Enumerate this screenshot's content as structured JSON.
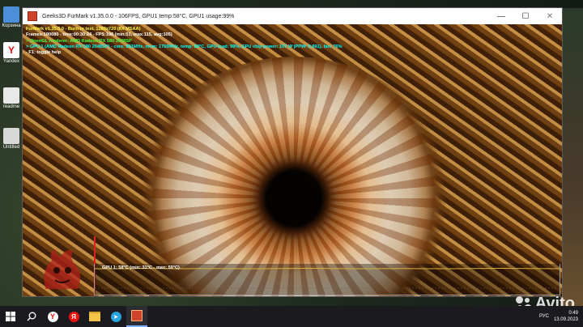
{
  "window": {
    "title": "Geeks3D FurMark v1.35.0.0 - 106FPS, GPU1 temp:58°C, GPU1 usage:99%",
    "min_glyph": "—",
    "max_glyph": "☐",
    "close_glyph": "✕"
  },
  "desktop": {
    "icons": [
      {
        "label": "Корзина"
      },
      {
        "label": "Yandex"
      },
      {
        "label": "readme"
      },
      {
        "label": "Untitled"
      }
    ]
  },
  "hud": {
    "lines": [
      "FurMark v1.35.0.0 - Burn-in test, 1280x720 (8X MSAA)",
      "Frames:190080 - time:00:30:24 - FPS:106 (min:51, max:115, avg:105)",
      "> OpenGL renderer: AMD Radeon RX 580 2048SP",
      "> GPU 1 (AMD Radeon RX 580 2048SP) - core: 891MHz, mem: 1750MHz, temp: 58°C, GPU load: 99%, GPU chip power: 107 W (PPW: 0.991), fan: 76%",
      "- F1: toggle help"
    ],
    "gpu_temp_label": "GPU 1: 58°C (min: 31°C - max: 59°C)"
  },
  "taskbar": {
    "items": [
      {
        "icon": "windows-start-icon"
      },
      {
        "icon": "search-icon"
      },
      {
        "icon": "yandex-browser-icon"
      },
      {
        "icon": "yandex-icon"
      },
      {
        "icon": "file-explorer-icon"
      },
      {
        "icon": "telegram-icon"
      },
      {
        "icon": "furmark-icon"
      }
    ],
    "language": "РУС",
    "time": "0:49",
    "date": "13.09.2023"
  },
  "watermark": "Avito",
  "colors": {
    "hud_title": "#ffff40",
    "hud_renderer": "#40ff40",
    "hud_gpu": "#00ffff",
    "temp_line": "#d8b040"
  }
}
